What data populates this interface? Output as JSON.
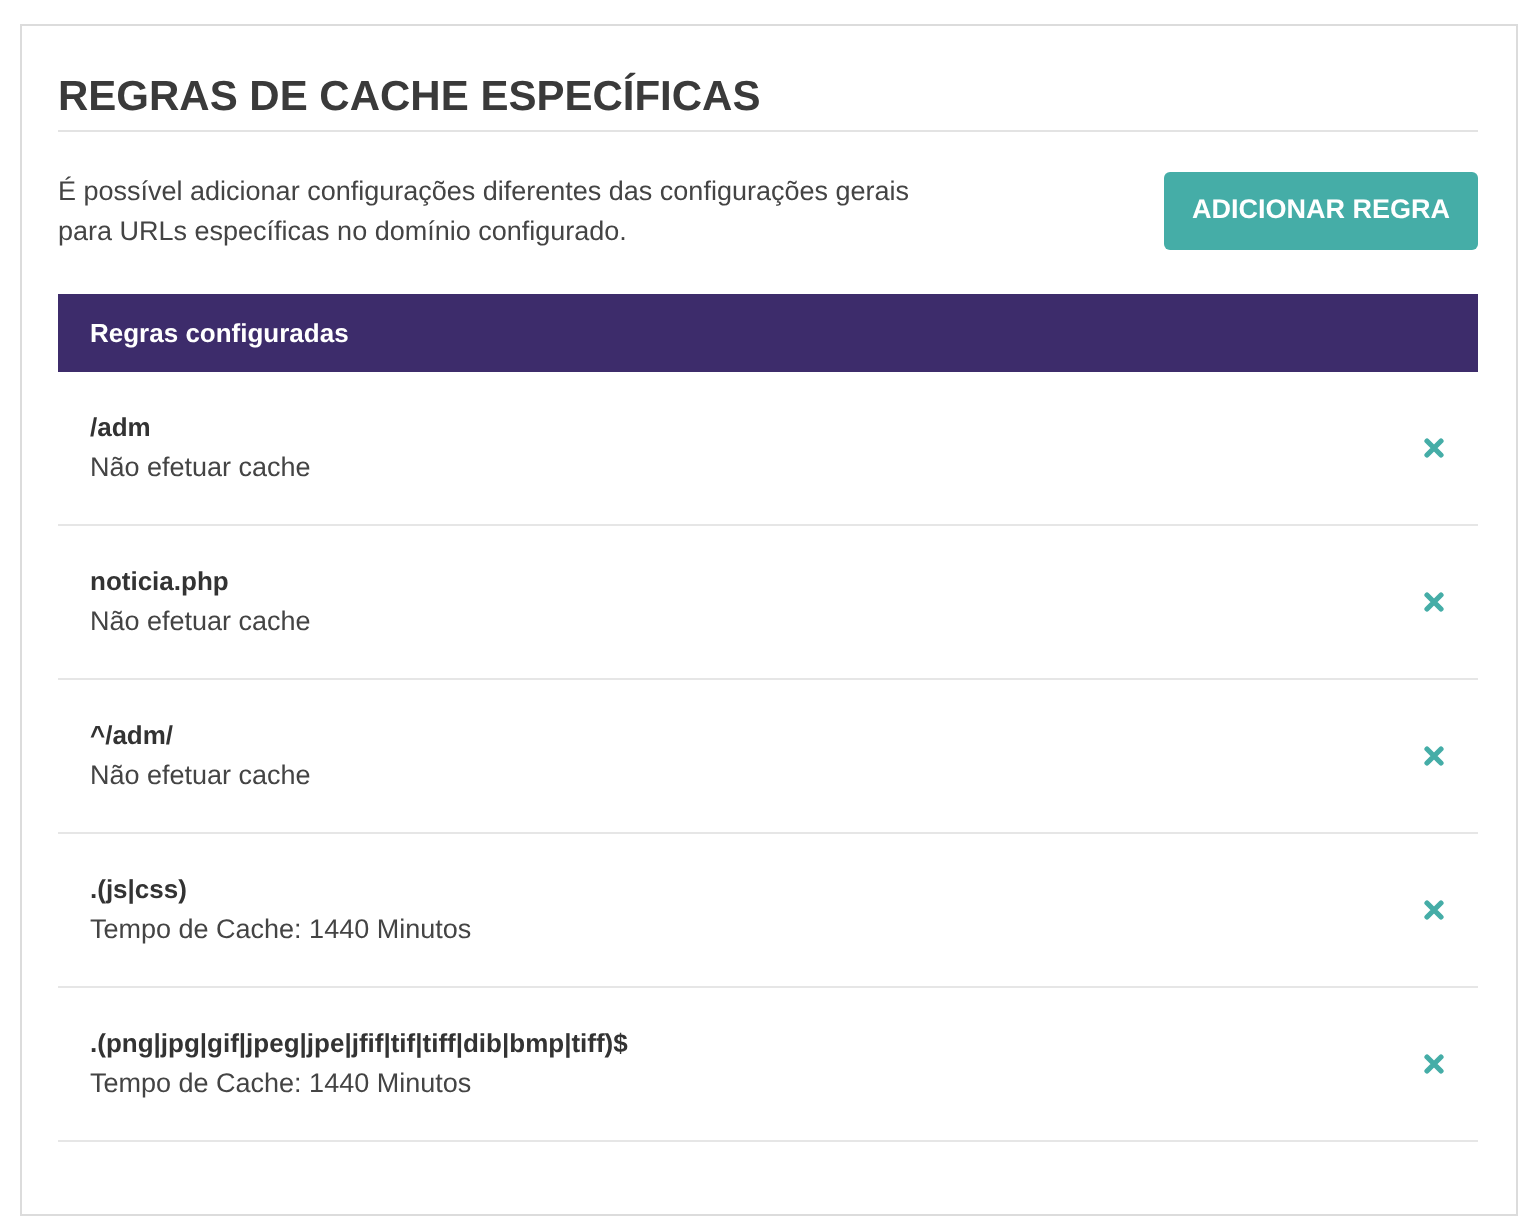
{
  "title": "REGRAS DE CACHE ESPECÍFICAS",
  "description": "É possível adicionar configurações diferentes das configurações gerais para URLs específicas no domínio configurado.",
  "add_button": "ADICIONAR REGRA",
  "table": {
    "header": "Regras configuradas",
    "rows": [
      {
        "pattern": "/adm",
        "setting": "Não efetuar cache"
      },
      {
        "pattern": "noticia.php",
        "setting": "Não efetuar cache"
      },
      {
        "pattern": "^/adm/",
        "setting": "Não efetuar cache"
      },
      {
        "pattern": ".(js|css)",
        "setting": "Tempo de Cache: 1440 Minutos"
      },
      {
        "pattern": ".(png|jpg|gif|jpeg|jpe|jfif|tif|tiff|dib|bmp|tiff)$",
        "setting": "Tempo de Cache: 1440 Minutos"
      }
    ]
  }
}
